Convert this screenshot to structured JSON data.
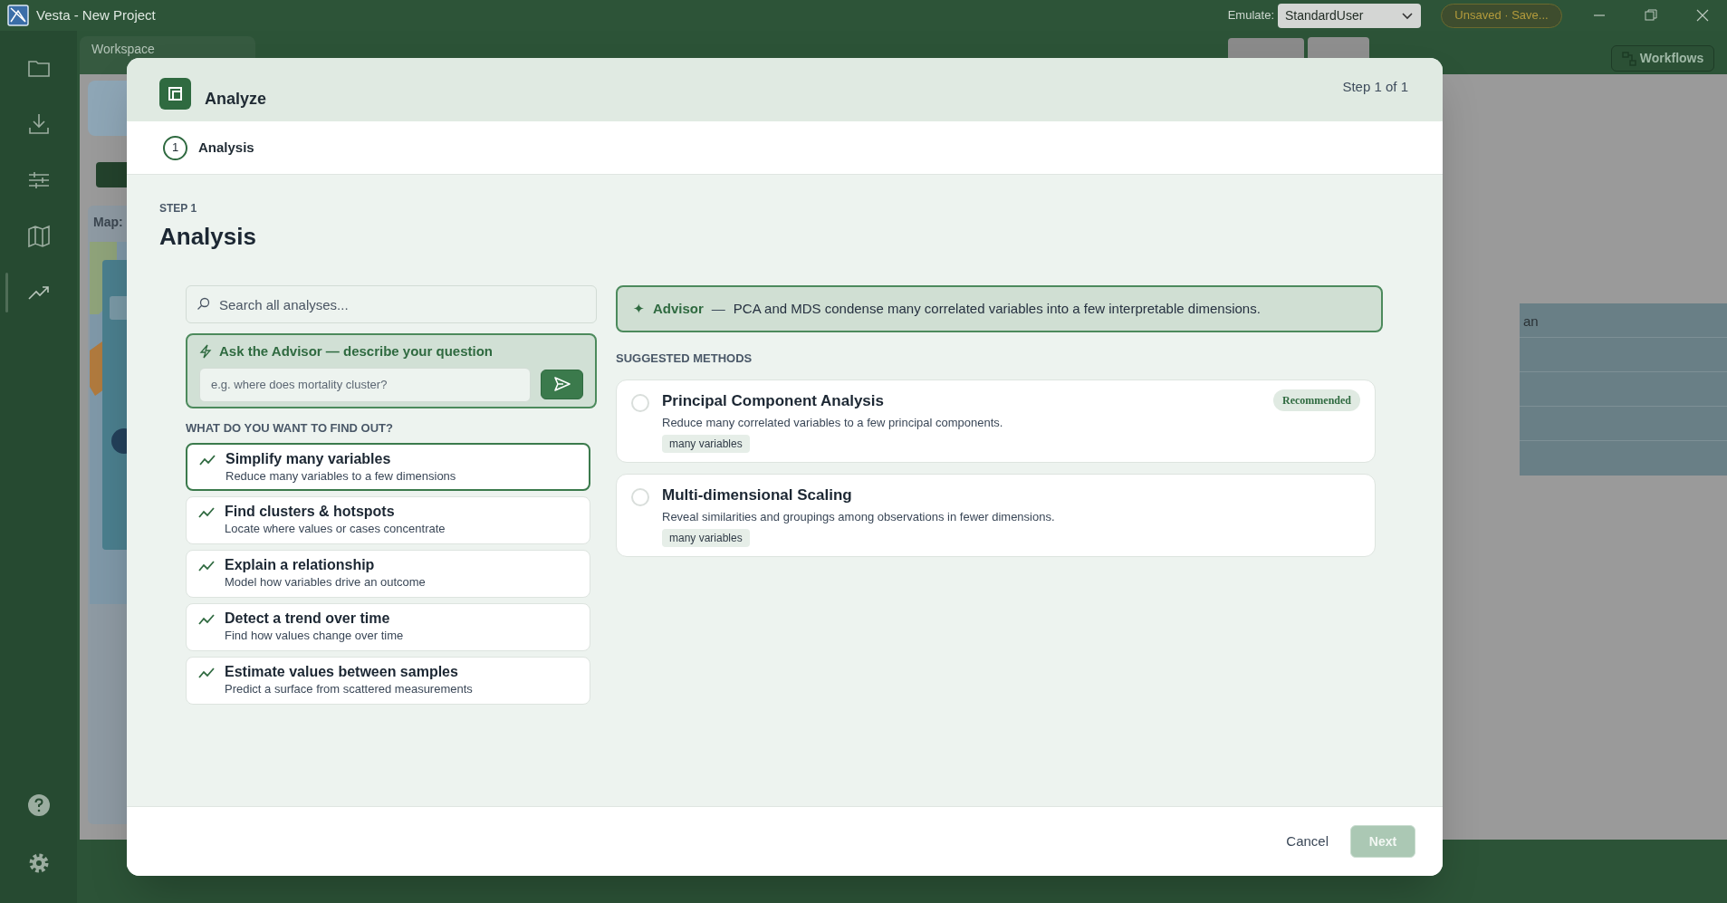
{
  "title_bar": {
    "title": "Vesta - New Project",
    "emulate_label": "Emulate:",
    "emulate_value": "StandardUser",
    "save_status": "Unsaved · Save..."
  },
  "sidebar": {
    "items": [
      {
        "kind": "folder",
        "selected": false
      },
      {
        "kind": "download",
        "selected": false
      },
      {
        "kind": "sliders",
        "selected": false
      },
      {
        "kind": "map",
        "selected": false
      },
      {
        "kind": "trend",
        "selected": true
      }
    ],
    "bottom_items": [
      {
        "kind": "help"
      },
      {
        "kind": "settings"
      }
    ]
  },
  "workspace": {
    "tab": "Workspace",
    "map_label": "Map:",
    "table_cell": "an",
    "workflows_button": "Workflows"
  },
  "dialog": {
    "title": "Analyze",
    "step_counter": "Step 1 of 1",
    "steps": [
      {
        "number": "1",
        "label": "Analysis",
        "selected": true
      }
    ],
    "step_eyebrow": "STEP 1",
    "step_title": "Analysis",
    "search": {
      "placeholder": "Search all analyses..."
    },
    "advisor_prompt": {
      "title": "Ask the Advisor — describe your question",
      "placeholder": "e.g. where does mortality cluster?"
    },
    "goals_heading": "WHAT DO YOU WANT TO FIND OUT?",
    "goals": [
      {
        "title": "Simplify many variables",
        "description": "Reduce many variables to a few dimensions",
        "selected": true
      },
      {
        "title": "Find clusters & hotspots",
        "description": "Locate where values or cases concentrate",
        "selected": false
      },
      {
        "title": "Explain a relationship",
        "description": "Model how variables drive an outcome",
        "selected": false
      },
      {
        "title": "Detect a trend over time",
        "description": "Find how values change over time",
        "selected": false
      },
      {
        "title": "Estimate values between samples",
        "description": "Predict a surface from scattered measurements",
        "selected": false
      }
    ],
    "advisor_note": {
      "icon": "✦",
      "label": "Advisor",
      "separator": "—",
      "text": "PCA and MDS condense many correlated variables into a few interpretable dimensions."
    },
    "methods_heading": "SUGGESTED METHODS",
    "methods": [
      {
        "name": "Principal Component Analysis",
        "description": "Reduce many correlated variables to a few principal components.",
        "tags": [
          "many variables"
        ],
        "badge": "Recommended",
        "selected": false
      },
      {
        "name": "Multi-dimensional Scaling",
        "description": "Reveal similarities and groupings among observations in fewer dimensions.",
        "tags": [
          "many variables"
        ],
        "selected": false
      }
    ],
    "cancel_button": "Cancel",
    "next_button": {
      "label": "Next",
      "disabled": true
    }
  }
}
